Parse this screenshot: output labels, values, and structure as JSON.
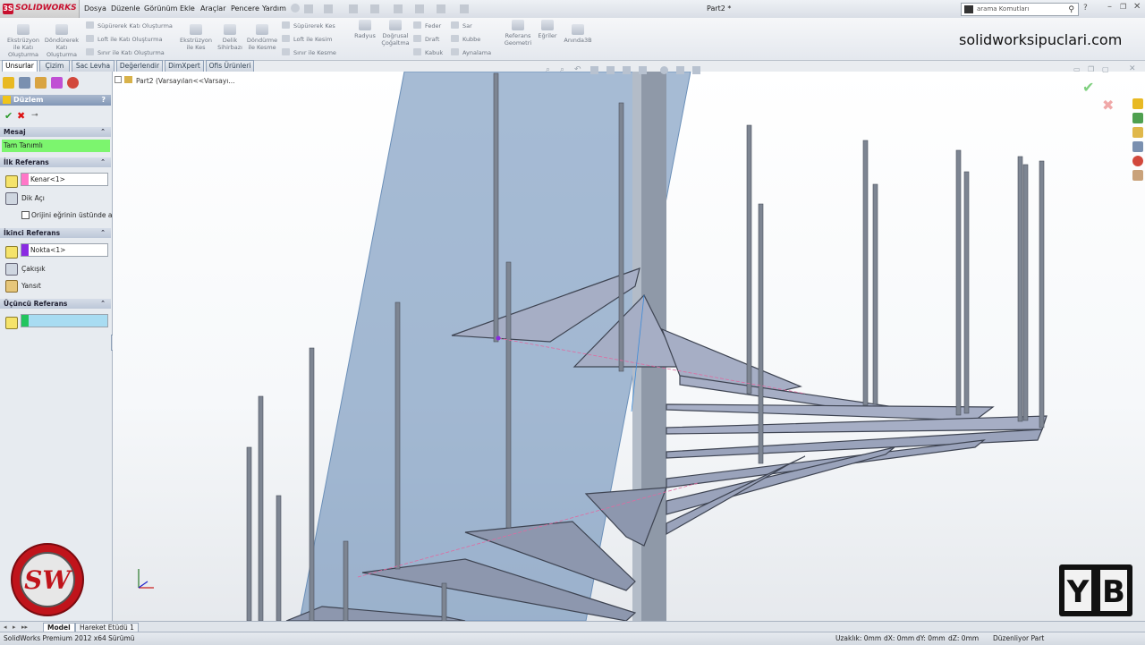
{
  "app": {
    "logo_text": "SOLIDWORKS",
    "doc_title": "Part2 *"
  },
  "menu": [
    "Dosya",
    "Düzenle",
    "Görünüm",
    "Ekle",
    "Araçlar",
    "Pencere",
    "Yardım"
  ],
  "search": {
    "placeholder": "arama Komutları"
  },
  "command_manager": {
    "big_buttons_1": [
      "Ekstrüzyon\nile Katı\nOluşturma",
      "Döndürerek\nKatı\nOluşturma"
    ],
    "rows_1": [
      "Süpürerek Katı Oluşturma",
      "Loft ile Katı Oluşturma",
      "Sınır ile Katı Oluşturma"
    ],
    "big_buttons_2": [
      "Ekstrüzyon\nile Kes",
      "Delik\nSihirbazı",
      "Döndürme\nile Kesme"
    ],
    "rows_2": [
      "Süpürerek Kes",
      "Loft ile Kesim",
      "Sınır ile Kesme"
    ],
    "big_buttons_3": [
      "Radyus",
      "Doğrusal\nÇoğaltma"
    ],
    "rows_3": [
      "Feder",
      "Draft",
      "Kabuk"
    ],
    "rows_4": [
      "Sar",
      "Kubbe",
      "Aynalama"
    ],
    "big_buttons_4": [
      "Referans\nGeometri",
      "Eğriler",
      "Anında3B"
    ],
    "brand": "solidworksipuclari.com"
  },
  "tabs": [
    "Unsurlar",
    "Çizim",
    "Sac Levha",
    "Değerlendir",
    "DimXpert",
    "Ofis Ürünleri"
  ],
  "property_manager": {
    "title": "Düzlem",
    "help": "?",
    "message_header": "Mesaj",
    "message": "Tam Tanımlı",
    "first_ref": {
      "header": "İlk Referans",
      "value": "Kenar<1>",
      "opt1": "Dik Açı",
      "opt2": "Orijini eğrinin üstünde a"
    },
    "second_ref": {
      "header": "İkinci Referans",
      "value": "Nokta<1>",
      "opt1": "Çakışık",
      "opt2": "Yansıt"
    },
    "third_ref": {
      "header": "Üçüncü Referans",
      "value": ""
    },
    "colors": {
      "first": "#ff77c8",
      "second": "#8a2be2",
      "third": "#22c55e",
      "message_bg": "#7cf56e"
    }
  },
  "tree": {
    "label": "Part2  (Varsayılan<<Varsayı..."
  },
  "bottom_tabs": [
    "Model",
    "Hareket Etüdü 1"
  ],
  "status": {
    "version": "SolidWorks Premium 2012 x64 Sürümü",
    "distance": "Uzaklık: 0mm",
    "dx": "dX: 0mm",
    "dy": "dY: 0mm",
    "dz": "dZ: 0mm",
    "mode": "Düzenliyor Part"
  }
}
